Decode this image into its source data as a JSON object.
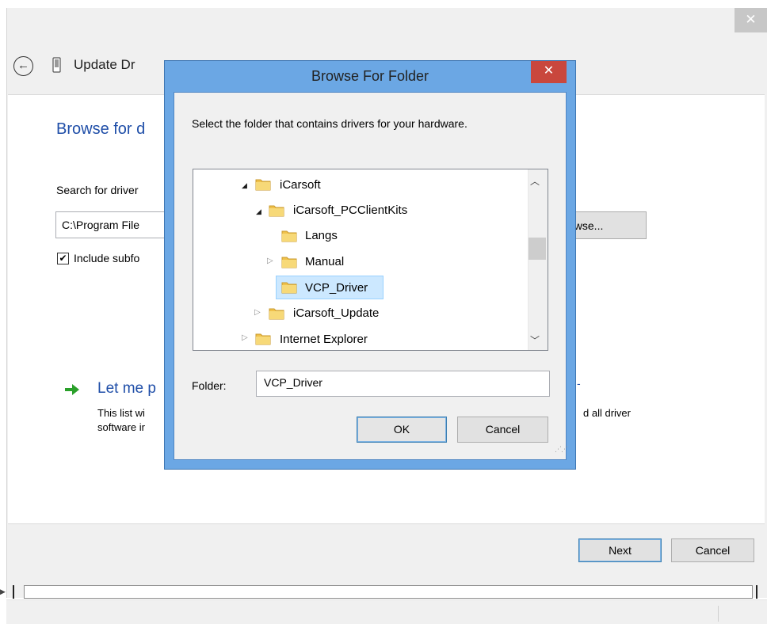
{
  "wizard": {
    "close_glyph": "✕",
    "back_glyph": "←",
    "title": "Update Dr",
    "heading": "Browse for d",
    "search_label": "Search for driver",
    "path_value": "C:\\Program File",
    "browse_label": "owse...",
    "include_subfolders_checked": true,
    "include_subfolders_label": "Include subfo",
    "let_me_title": "Let me p",
    "let_me_dash": "-",
    "let_me_desc_line1": "This list wi",
    "let_me_desc_line2": "software ir",
    "let_me_desc_right": "d all driver",
    "next_label": "Next",
    "cancel_label": "Cancel"
  },
  "dialog": {
    "title": "Browse For Folder",
    "close_glyph": "✕",
    "instructions": "Select the folder that contains drivers for your hardware.",
    "tree": [
      {
        "label": "iCarsoft",
        "expander": "open",
        "selected": false
      },
      {
        "label": "iCarsoft_PCClientKits",
        "expander": "open",
        "selected": false
      },
      {
        "label": "Langs",
        "expander": "none",
        "selected": false
      },
      {
        "label": "Manual",
        "expander": "closed",
        "selected": false
      },
      {
        "label": "VCP_Driver",
        "expander": "none",
        "selected": true
      },
      {
        "label": "iCarsoft_Update",
        "expander": "closed",
        "selected": false
      },
      {
        "label": "Internet Explorer",
        "expander": "closed",
        "selected": false
      }
    ],
    "folder_label": "Folder:",
    "folder_value": "VCP_Driver",
    "ok_label": "OK",
    "cancel_label": "Cancel"
  },
  "colors": {
    "link_blue": "#1f4ea8",
    "dialog_frame": "#6ba7e4",
    "close_red": "#c9473d",
    "selection": "#cce8ff",
    "folder_yellow": "#f0c14b"
  }
}
